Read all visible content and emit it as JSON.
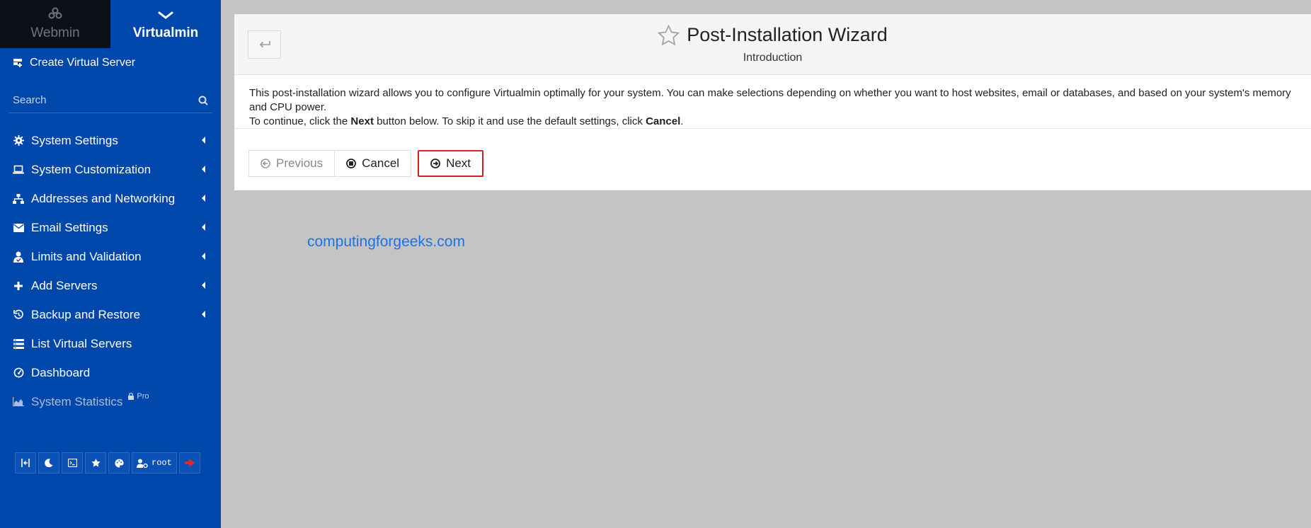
{
  "switcher": {
    "webmin": "Webmin",
    "virtualmin": "Virtualmin"
  },
  "sidebar": {
    "create": "Create Virtual Server",
    "search_placeholder": "Search",
    "items": [
      {
        "label": "System Settings",
        "icon": "gear-icon"
      },
      {
        "label": "System Customization",
        "icon": "laptop-icon"
      },
      {
        "label": "Addresses and Networking",
        "icon": "network-icon"
      },
      {
        "label": "Email Settings",
        "icon": "envelope-icon"
      },
      {
        "label": "Limits and Validation",
        "icon": "user-check-icon"
      },
      {
        "label": "Add Servers",
        "icon": "plus-icon"
      },
      {
        "label": "Backup and Restore",
        "icon": "history-icon"
      },
      {
        "label": "List Virtual Servers",
        "icon": "list-icon"
      },
      {
        "label": "Dashboard",
        "icon": "gauge-icon"
      },
      {
        "label": "System Statistics",
        "icon": "chart-icon",
        "badge": "Pro"
      }
    ],
    "toolbar_user": "root"
  },
  "main": {
    "title": "Post-Installation Wizard",
    "subtitle": "Introduction",
    "para1": "This post-installation wizard allows you to configure Virtualmin optimally for your system. You can make selections depending on whether you want to host websites, email or databases, and based on your system's memory and CPU power.",
    "para2_pre": "To continue, click the ",
    "para2_next": "Next",
    "para2_mid": " button below. To skip it and use the default settings, click ",
    "para2_cancel": "Cancel",
    "para2_end": ".",
    "buttons": {
      "previous": "Previous",
      "cancel": "Cancel",
      "next": "Next"
    }
  },
  "watermark": "computingforgeeks.com",
  "colors": {
    "sidebar": "#0047ab",
    "webmin_tab": "#0d1117",
    "highlight": "#d62020",
    "watermark": "#1a73e8"
  }
}
